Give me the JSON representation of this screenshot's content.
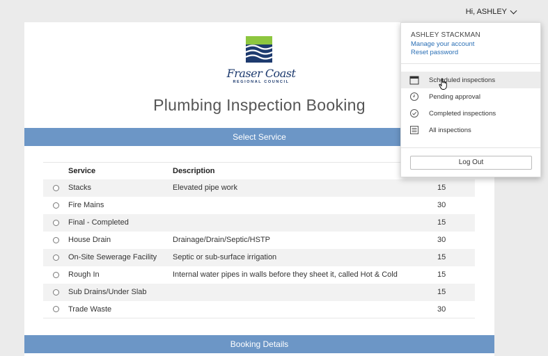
{
  "header": {
    "greeting": "Hi, ASHLEY"
  },
  "logo": {
    "name": "Fraser Coast",
    "subtitle": "REGIONAL COUNCIL"
  },
  "page": {
    "title": "Plumbing Inspection Booking"
  },
  "sections": {
    "select_service": "Select Service",
    "booking_details": "Booking Details"
  },
  "table": {
    "headers": {
      "service": "Service",
      "description": "Description"
    },
    "rows": [
      {
        "service": "Stacks",
        "description": "Elevated pipe work",
        "value": "15"
      },
      {
        "service": "Fire Mains",
        "description": "",
        "value": "30"
      },
      {
        "service": "Final - Completed",
        "description": "",
        "value": "15"
      },
      {
        "service": "House Drain",
        "description": "Drainage/Drain/Septic/HSTP",
        "value": "30"
      },
      {
        "service": "On-Site Sewerage Facility",
        "description": "Septic or sub-surface irrigation",
        "value": "15"
      },
      {
        "service": "Rough In",
        "description": "Internal water pipes in walls before they sheet it, called Hot & Cold",
        "value": "15"
      },
      {
        "service": "Sub Drains/Under Slab",
        "description": "",
        "value": "15"
      },
      {
        "service": "Trade Waste",
        "description": "",
        "value": "30"
      }
    ]
  },
  "dropdown": {
    "name": "ASHLEY STACKMAN",
    "manage_account": "Manage your account",
    "reset_password": "Reset password",
    "items": [
      {
        "label": "Scheduled inspections",
        "icon": "calendar-icon"
      },
      {
        "label": "Pending approval",
        "icon": "clock-icon"
      },
      {
        "label": "Completed inspections",
        "icon": "check-circle-icon"
      },
      {
        "label": "All inspections",
        "icon": "list-icon"
      }
    ],
    "logout": "Log Out"
  },
  "colors": {
    "section_bar": "#6c96c6",
    "link": "#2a6fb5",
    "logo_blue": "#1d3a6e",
    "logo_green": "#8dc63f"
  }
}
